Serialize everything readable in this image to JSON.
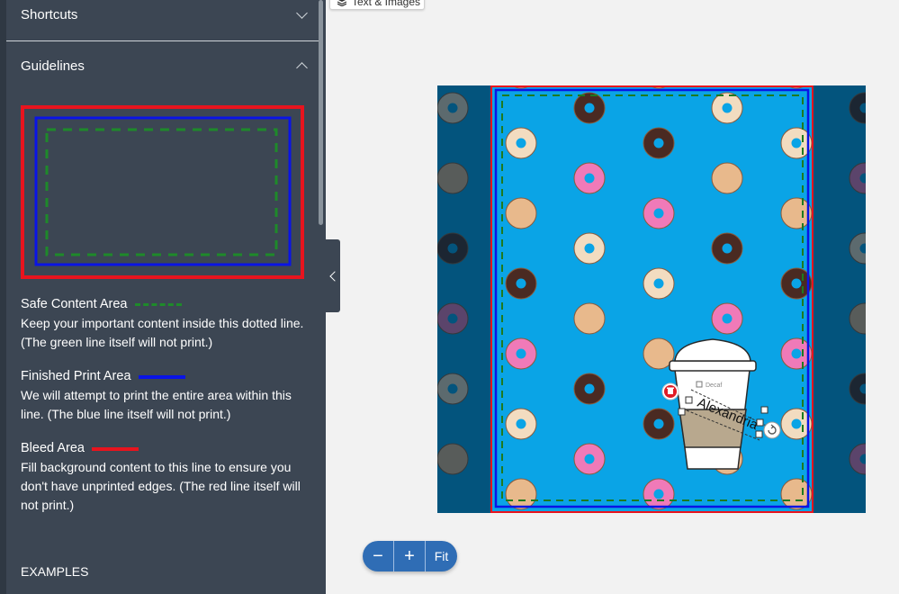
{
  "toolbar": {
    "tab_label": "Text & Images"
  },
  "sidebar": {
    "shortcuts_label": "Shortcuts",
    "guidelines_label": "Guidelines",
    "examples_label": "EXAMPLES",
    "legend": [
      {
        "title": "Safe Content Area",
        "desc": "Keep your important content inside this dotted line. (The green line itself will not print.)",
        "color": "#1e8a2a",
        "style": "dashed"
      },
      {
        "title": "Finished Print Area",
        "desc": "We will attempt to print the entire area within this line. (The blue line itself will not print.)",
        "color": "#0a14e6",
        "style": "solid"
      },
      {
        "title": "Bleed Area",
        "desc": "Fill background content to this line to ensure you don't have unprinted edges. (The red line itself will not print.)",
        "color": "#e8141e",
        "style": "solid"
      }
    ]
  },
  "canvas": {
    "background": "#0aa4e6",
    "cup": {
      "name_text": "Alexandria",
      "label_text": "Decaf"
    }
  },
  "zoom": {
    "minus": "−",
    "plus": "+",
    "fit": "Fit"
  },
  "icons": {
    "layers": "layers-icon",
    "trash": "trash-icon",
    "rotate": "rotate-icon"
  }
}
